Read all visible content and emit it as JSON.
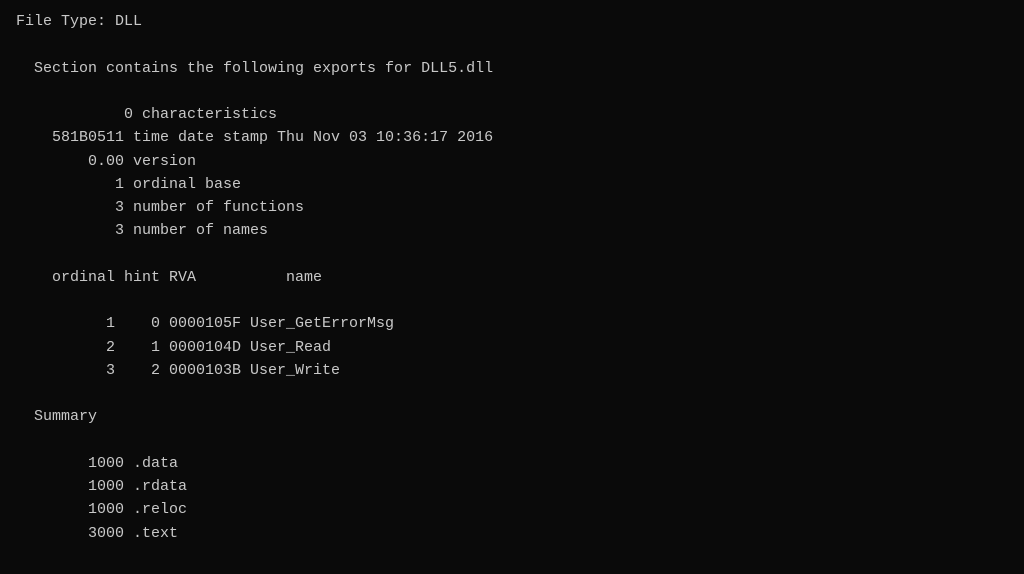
{
  "terminal": {
    "lines": [
      "File Type: DLL",
      "",
      "  Section contains the following exports for DLL5.dll",
      "",
      "            0 characteristics",
      "    581B0511 time date stamp Thu Nov 03 10:36:17 2016",
      "        0.00 version",
      "           1 ordinal base",
      "           3 number of functions",
      "           3 number of names",
      "",
      "    ordinal hint RVA          name",
      "",
      "          1    0 0000105F User_GetErrorMsg",
      "          2    1 0000104D User_Read",
      "          3    2 0000103B User_Write",
      "",
      "  Summary",
      "",
      "        1000 .data",
      "        1000 .rdata",
      "        1000 .reloc",
      "        3000 .text"
    ]
  }
}
